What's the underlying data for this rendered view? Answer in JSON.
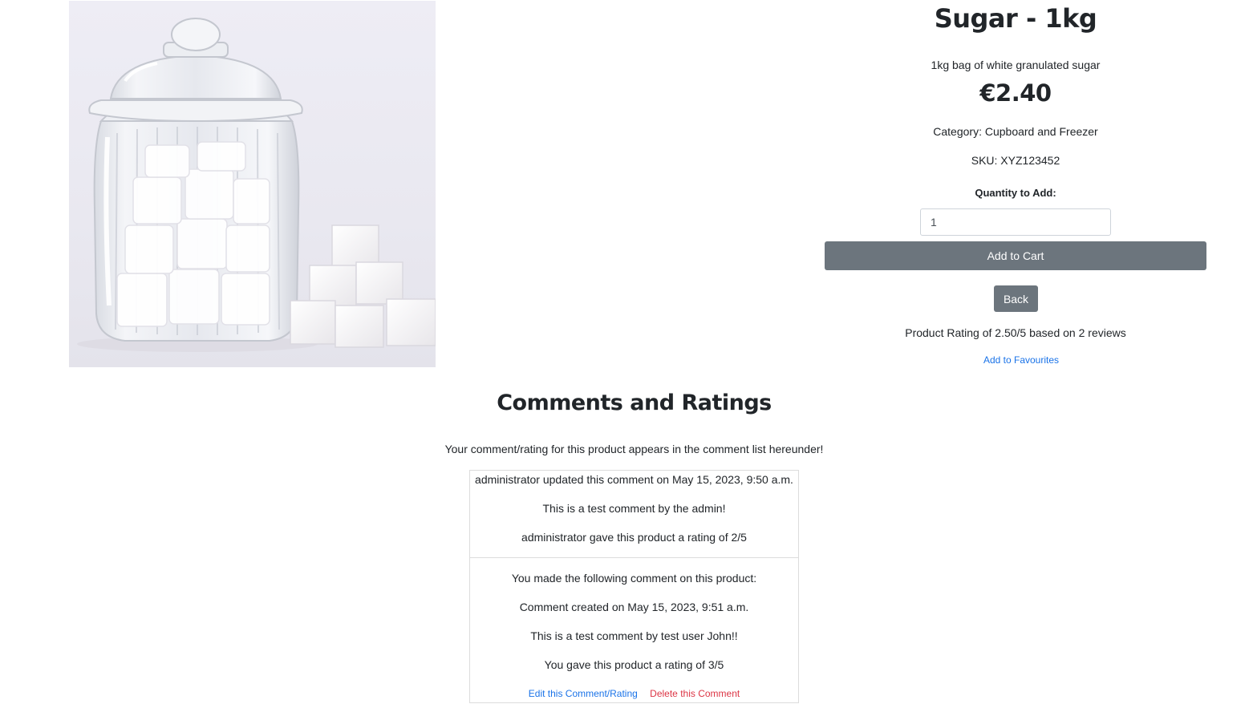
{
  "product": {
    "title": "Sugar - 1kg",
    "description": "1kg bag of white granulated sugar",
    "price": "€2.40",
    "category": "Category: Cupboard and Freezer",
    "sku": "SKU: XYZ123452",
    "quantity_label": "Quantity to Add:",
    "quantity_value": "1",
    "add_to_cart_label": "Add to Cart",
    "back_label": "Back",
    "rating_summary": "Product Rating of 2.50/5 based on 2 reviews",
    "add_to_favourites_label": "Add to Favourites",
    "image_icon": "sugar-jar-photo"
  },
  "comments": {
    "heading": "Comments and Ratings",
    "note": "Your comment/rating for this product appears in the comment list hereunder!",
    "items": [
      {
        "header": "administrator updated this comment on May 15, 2023, 9:50 a.m.",
        "body": "This is a test comment by the admin!",
        "rating": "administrator gave this product a rating of 2/5"
      },
      {
        "intro": "You made the following comment on this product:",
        "header": "Comment created on May 15, 2023, 9:51 a.m.",
        "body": "This is a test comment by test user John!!",
        "rating": "You gave this product a rating of 3/5",
        "edit_label": "Edit this Comment/Rating",
        "delete_label": "Delete this Comment"
      }
    ]
  },
  "colors": {
    "button_bg": "#6c757d",
    "link": "#1a73e8",
    "danger": "#dc3545"
  }
}
